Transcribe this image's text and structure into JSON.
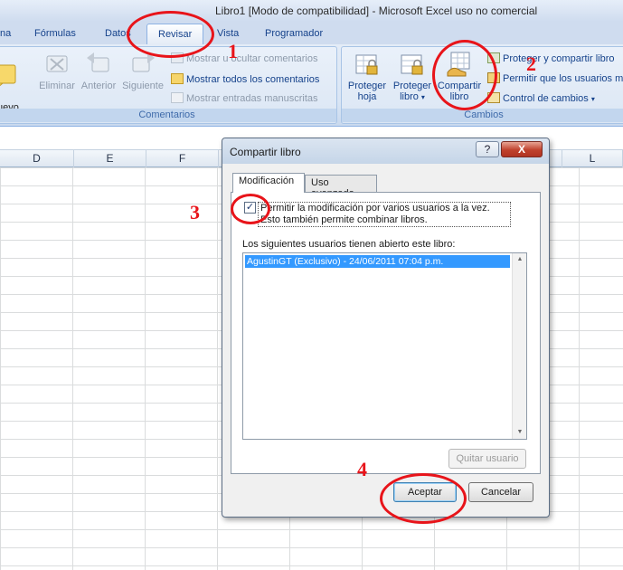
{
  "window": {
    "title": "Libro1  [Modo de compatibilidad] - Microsoft Excel uso no comercial"
  },
  "tabs": [
    {
      "label": "na"
    },
    {
      "label": "Fórmulas"
    },
    {
      "label": "Datos"
    },
    {
      "label": "Revisar"
    },
    {
      "label": "Vista"
    },
    {
      "label": "Programador"
    }
  ],
  "ribbon": {
    "comentarios": {
      "label": "Comentarios",
      "nuevo": "uevo\nentario",
      "eliminar": "Eliminar",
      "anterior": "Anterior",
      "siguiente": "Siguiente",
      "mostrar_ocultar": "Mostrar u ocultar comentarios",
      "mostrar_todos": "Mostrar todos los comentarios",
      "mostrar_manuscritas": "Mostrar entradas manuscritas"
    },
    "cambios": {
      "label": "Cambios",
      "proteger_hoja_1": "Proteger",
      "proteger_hoja_2": "hoja",
      "proteger_libro_1": "Proteger",
      "proteger_libro_2": "libro",
      "compartir_libro_1": "Compartir",
      "compartir_libro_2": "libro",
      "proteger_compartir": "Proteger y compartir libro",
      "permitir_usuarios": "Permitir que los usuarios m",
      "control_cambios": "Control de cambios"
    }
  },
  "sheet": {
    "columns": [
      "D",
      "E",
      "F",
      "L"
    ]
  },
  "dialog": {
    "title": "Compartir libro",
    "help": "?",
    "close": "X",
    "tab_modificacion": "Modificación",
    "tab_avanzado": "Uso avanzado",
    "checkbox_label": "Permitir la modificación por varios usuarios a la vez. Esto también permite combinar libros.",
    "checkbox_checked": true,
    "checkbox_mark": "✓",
    "users_label": "Los siguientes usuarios tienen abierto este libro:",
    "users": [
      "AgustinGT (Exclusivo) - 24/06/2011 07:04 p.m."
    ],
    "quitar": "Quitar usuario",
    "aceptar": "Aceptar",
    "cancelar": "Cancelar"
  },
  "annotations": [
    "1",
    "2",
    "3",
    "4"
  ],
  "colors": {
    "annotation": "#e8141a",
    "selection": "#3399ff",
    "ribbon_text": "#15428b"
  }
}
